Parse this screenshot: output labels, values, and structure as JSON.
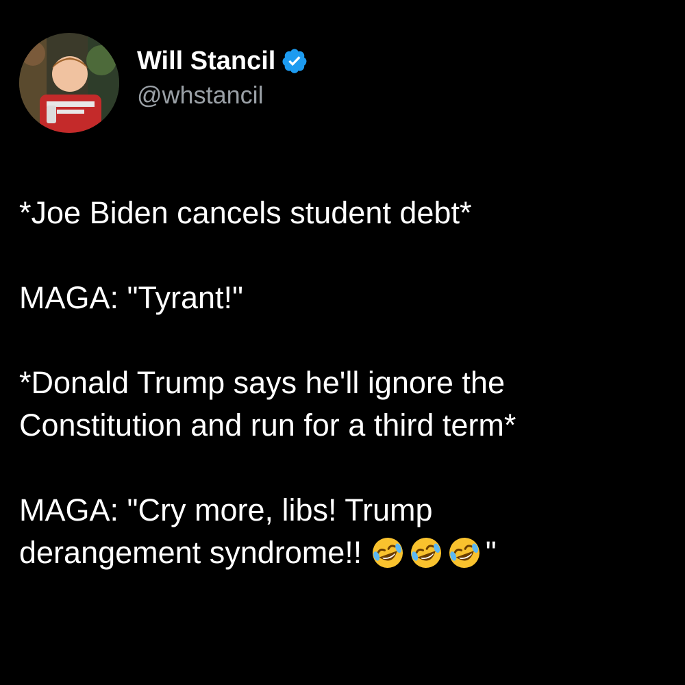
{
  "author": {
    "display_name": "Will Stancil",
    "handle": "@whstancil",
    "verified_icon": "verified-badge-icon",
    "verified_color": "#1d9bf0"
  },
  "tweet": {
    "line1": "*Joe Biden cancels student debt*",
    "line2": "MAGA: \"Tyrant!\"",
    "line3a": "*Donald Trump says he'll ignore the",
    "line3b": "Constitution and run for a third term*",
    "line4a": "MAGA: \"Cry more, libs! Trump",
    "line4b_text": "derangement syndrome!! ",
    "line4b_emoji_name": "rolling-on-floor-laughing-emoji",
    "line4b_emoji_count": 3,
    "line4b_end": "\""
  },
  "colors": {
    "background": "#000000",
    "text": "#ffffff",
    "handle": "#9aa0a6"
  }
}
